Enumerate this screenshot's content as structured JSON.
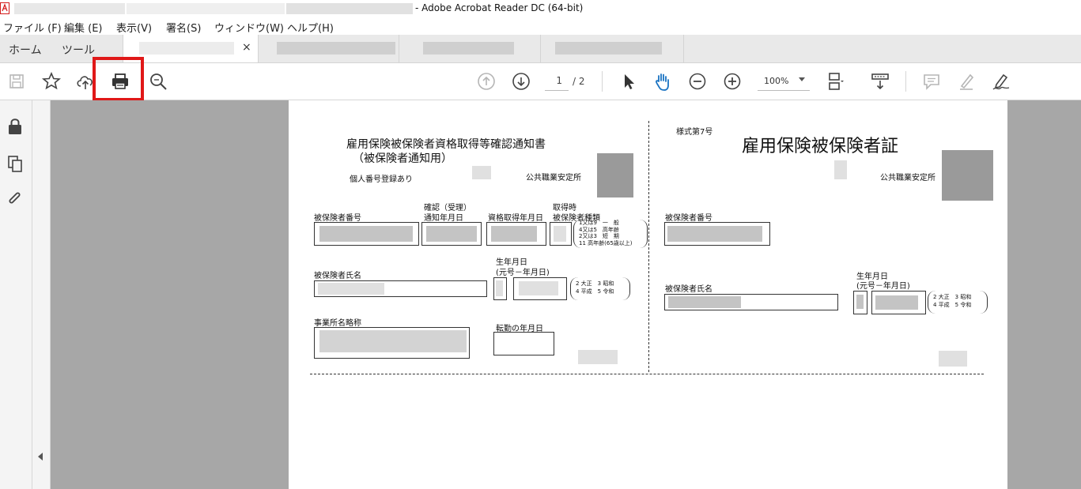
{
  "window": {
    "title": "- Adobe Acrobat Reader DC (64-bit)"
  },
  "menu": [
    "ファイル (F)",
    "編集 (E)",
    "表示(V)",
    "署名(S)",
    "ウィンドウ(W)",
    "ヘルプ(H)"
  ],
  "tabs": {
    "home": "ホーム",
    "tools": "ツール",
    "close": "×"
  },
  "toolbar": {
    "page_current": "1",
    "page_total": "/ 2",
    "zoom": "100%",
    "icons": [
      "save-icon",
      "bookmark-star-icon",
      "upload-cloud-icon",
      "print-icon",
      "search-zoom-icon",
      "prev-page-icon",
      "next-page-icon",
      "select-cursor-icon",
      "hand-tool-icon",
      "zoom-out-icon",
      "zoom-in-icon",
      "page-fit-icon",
      "scroll-mode-icon",
      "comment-icon",
      "highlight-pen-icon",
      "sign-icon"
    ]
  },
  "left_panel": {
    "icons": [
      "lock-icon",
      "pages-icon",
      "attachment-icon"
    ]
  },
  "highlight_color": "#e01818",
  "document": {
    "left": {
      "title1": "雇用保険被保険者資格取得等確認通知書",
      "title2": "（被保険者通知用）",
      "mynumber": "個人番号登録あり",
      "office": "公共職業安定所",
      "insured_no": "被保険者番号",
      "confirm1": "確認（受理）",
      "confirm2": "通知年月日",
      "acq_date": "資格取得年月日",
      "type1": "取得時",
      "type2": "被保険者種類",
      "type_opts": [
        "1又は9　一　般",
        "4又は5　高年齢",
        "2又は3　短　期",
        "11 高年齢(65歳以上)"
      ],
      "name": "被保険者氏名",
      "birth1": "生年月日",
      "birth2": "(元号－年月日)",
      "era1": "2 大正　3 昭和",
      "era2": "4 平成　5 令和",
      "office_name": "事業所名略称",
      "transfer": "転勤の年月日"
    },
    "right": {
      "form_no": "様式第7号",
      "title": "雇用保険被保険者証",
      "office": "公共職業安定所",
      "insured_no": "被保険者番号",
      "birth1": "生年月日",
      "birth2": "(元号－年月日)",
      "name": "被保険者氏名",
      "era1": "2 大正　3 昭和",
      "era2": "4 平成　5 令和"
    }
  }
}
